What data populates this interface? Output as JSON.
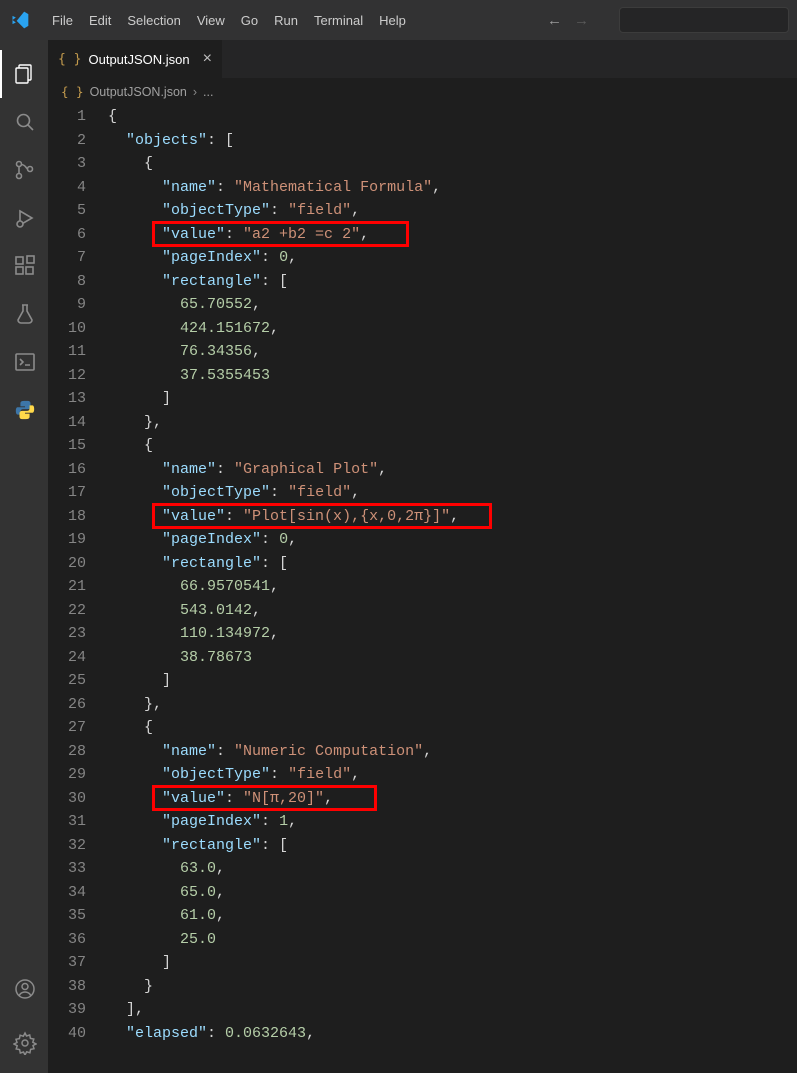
{
  "menu": [
    "File",
    "Edit",
    "Selection",
    "View",
    "Go",
    "Run",
    "Terminal",
    "Help"
  ],
  "tab": {
    "icon_label": "{ }",
    "filename": "OutputJSON.json"
  },
  "breadcrumbs": {
    "icon_label": "{ }",
    "filename": "OutputJSON.json",
    "sep": "›",
    "tail": "..."
  },
  "code": {
    "lines": [
      {
        "n": 1,
        "ind": 0,
        "seg": [
          {
            "t": "{",
            "c": "brace"
          }
        ]
      },
      {
        "n": 2,
        "ind": 2,
        "seg": [
          {
            "t": "\"objects\"",
            "c": "key"
          },
          {
            "t": ": [",
            "c": "punc"
          }
        ]
      },
      {
        "n": 3,
        "ind": 4,
        "seg": [
          {
            "t": "{",
            "c": "brace"
          }
        ]
      },
      {
        "n": 4,
        "ind": 6,
        "seg": [
          {
            "t": "\"name\"",
            "c": "key"
          },
          {
            "t": ": ",
            "c": "punc"
          },
          {
            "t": "\"Mathematical Formula\"",
            "c": "str"
          },
          {
            "t": ",",
            "c": "punc"
          }
        ]
      },
      {
        "n": 5,
        "ind": 6,
        "seg": [
          {
            "t": "\"objectType\"",
            "c": "key"
          },
          {
            "t": ": ",
            "c": "punc"
          },
          {
            "t": "\"field\"",
            "c": "str"
          },
          {
            "t": ",",
            "c": "punc"
          }
        ]
      },
      {
        "n": 6,
        "ind": 6,
        "seg": [
          {
            "t": "\"value\"",
            "c": "key"
          },
          {
            "t": ": ",
            "c": "punc"
          },
          {
            "t": "\"a2 +b2 =c 2\"",
            "c": "str"
          },
          {
            "t": ",",
            "c": "punc"
          }
        ],
        "redbox_w": 257
      },
      {
        "n": 7,
        "ind": 6,
        "seg": [
          {
            "t": "\"pageIndex\"",
            "c": "key"
          },
          {
            "t": ": ",
            "c": "punc"
          },
          {
            "t": "0",
            "c": "num"
          },
          {
            "t": ",",
            "c": "punc"
          }
        ]
      },
      {
        "n": 8,
        "ind": 6,
        "seg": [
          {
            "t": "\"rectangle\"",
            "c": "key"
          },
          {
            "t": ": [",
            "c": "punc"
          }
        ]
      },
      {
        "n": 9,
        "ind": 8,
        "seg": [
          {
            "t": "65.70552",
            "c": "num"
          },
          {
            "t": ",",
            "c": "punc"
          }
        ]
      },
      {
        "n": 10,
        "ind": 8,
        "seg": [
          {
            "t": "424.151672",
            "c": "num"
          },
          {
            "t": ",",
            "c": "punc"
          }
        ]
      },
      {
        "n": 11,
        "ind": 8,
        "seg": [
          {
            "t": "76.34356",
            "c": "num"
          },
          {
            "t": ",",
            "c": "punc"
          }
        ]
      },
      {
        "n": 12,
        "ind": 8,
        "seg": [
          {
            "t": "37.5355453",
            "c": "num"
          }
        ]
      },
      {
        "n": 13,
        "ind": 6,
        "seg": [
          {
            "t": "]",
            "c": "brace"
          }
        ]
      },
      {
        "n": 14,
        "ind": 4,
        "seg": [
          {
            "t": "},",
            "c": "brace"
          }
        ]
      },
      {
        "n": 15,
        "ind": 4,
        "seg": [
          {
            "t": "{",
            "c": "brace"
          }
        ]
      },
      {
        "n": 16,
        "ind": 6,
        "seg": [
          {
            "t": "\"name\"",
            "c": "key"
          },
          {
            "t": ": ",
            "c": "punc"
          },
          {
            "t": "\"Graphical Plot\"",
            "c": "str"
          },
          {
            "t": ",",
            "c": "punc"
          }
        ]
      },
      {
        "n": 17,
        "ind": 6,
        "seg": [
          {
            "t": "\"objectType\"",
            "c": "key"
          },
          {
            "t": ": ",
            "c": "punc"
          },
          {
            "t": "\"field\"",
            "c": "str"
          },
          {
            "t": ",",
            "c": "punc"
          }
        ]
      },
      {
        "n": 18,
        "ind": 6,
        "seg": [
          {
            "t": "\"value\"",
            "c": "key"
          },
          {
            "t": ": ",
            "c": "punc"
          },
          {
            "t": "\"Plot[sin(x),{x,0,2π}]\"",
            "c": "str"
          },
          {
            "t": ",",
            "c": "punc"
          }
        ],
        "redbox_w": 340
      },
      {
        "n": 19,
        "ind": 6,
        "seg": [
          {
            "t": "\"pageIndex\"",
            "c": "key"
          },
          {
            "t": ": ",
            "c": "punc"
          },
          {
            "t": "0",
            "c": "num"
          },
          {
            "t": ",",
            "c": "punc"
          }
        ]
      },
      {
        "n": 20,
        "ind": 6,
        "seg": [
          {
            "t": "\"rectangle\"",
            "c": "key"
          },
          {
            "t": ": [",
            "c": "punc"
          }
        ]
      },
      {
        "n": 21,
        "ind": 8,
        "seg": [
          {
            "t": "66.9570541",
            "c": "num"
          },
          {
            "t": ",",
            "c": "punc"
          }
        ]
      },
      {
        "n": 22,
        "ind": 8,
        "seg": [
          {
            "t": "543.0142",
            "c": "num"
          },
          {
            "t": ",",
            "c": "punc"
          }
        ]
      },
      {
        "n": 23,
        "ind": 8,
        "seg": [
          {
            "t": "110.134972",
            "c": "num"
          },
          {
            "t": ",",
            "c": "punc"
          }
        ]
      },
      {
        "n": 24,
        "ind": 8,
        "seg": [
          {
            "t": "38.78673",
            "c": "num"
          }
        ]
      },
      {
        "n": 25,
        "ind": 6,
        "seg": [
          {
            "t": "]",
            "c": "brace"
          }
        ]
      },
      {
        "n": 26,
        "ind": 4,
        "seg": [
          {
            "t": "},",
            "c": "brace"
          }
        ]
      },
      {
        "n": 27,
        "ind": 4,
        "seg": [
          {
            "t": "{",
            "c": "brace"
          }
        ]
      },
      {
        "n": 28,
        "ind": 6,
        "seg": [
          {
            "t": "\"name\"",
            "c": "key"
          },
          {
            "t": ": ",
            "c": "punc"
          },
          {
            "t": "\"Numeric Computation\"",
            "c": "str"
          },
          {
            "t": ",",
            "c": "punc"
          }
        ]
      },
      {
        "n": 29,
        "ind": 6,
        "seg": [
          {
            "t": "\"objectType\"",
            "c": "key"
          },
          {
            "t": ": ",
            "c": "punc"
          },
          {
            "t": "\"field\"",
            "c": "str"
          },
          {
            "t": ",",
            "c": "punc"
          }
        ]
      },
      {
        "n": 30,
        "ind": 6,
        "seg": [
          {
            "t": "\"value\"",
            "c": "key"
          },
          {
            "t": ": ",
            "c": "punc"
          },
          {
            "t": "\"N[π,20]\"",
            "c": "str"
          },
          {
            "t": ",",
            "c": "punc"
          }
        ],
        "redbox_w": 225
      },
      {
        "n": 31,
        "ind": 6,
        "seg": [
          {
            "t": "\"pageIndex\"",
            "c": "key"
          },
          {
            "t": ": ",
            "c": "punc"
          },
          {
            "t": "1",
            "c": "num"
          },
          {
            "t": ",",
            "c": "punc"
          }
        ]
      },
      {
        "n": 32,
        "ind": 6,
        "seg": [
          {
            "t": "\"rectangle\"",
            "c": "key"
          },
          {
            "t": ": [",
            "c": "punc"
          }
        ]
      },
      {
        "n": 33,
        "ind": 8,
        "seg": [
          {
            "t": "63.0",
            "c": "num"
          },
          {
            "t": ",",
            "c": "punc"
          }
        ]
      },
      {
        "n": 34,
        "ind": 8,
        "seg": [
          {
            "t": "65.0",
            "c": "num"
          },
          {
            "t": ",",
            "c": "punc"
          }
        ]
      },
      {
        "n": 35,
        "ind": 8,
        "seg": [
          {
            "t": "61.0",
            "c": "num"
          },
          {
            "t": ",",
            "c": "punc"
          }
        ]
      },
      {
        "n": 36,
        "ind": 8,
        "seg": [
          {
            "t": "25.0",
            "c": "num"
          }
        ]
      },
      {
        "n": 37,
        "ind": 6,
        "seg": [
          {
            "t": "]",
            "c": "brace"
          }
        ]
      },
      {
        "n": 38,
        "ind": 4,
        "seg": [
          {
            "t": "}",
            "c": "brace"
          }
        ]
      },
      {
        "n": 39,
        "ind": 2,
        "seg": [
          {
            "t": "],",
            "c": "brace"
          }
        ]
      },
      {
        "n": 40,
        "ind": 2,
        "seg": [
          {
            "t": "\"elapsed\"",
            "c": "key"
          },
          {
            "t": ": ",
            "c": "punc"
          },
          {
            "t": "0.0632643",
            "c": "num"
          },
          {
            "t": ",",
            "c": "punc"
          }
        ]
      }
    ]
  }
}
